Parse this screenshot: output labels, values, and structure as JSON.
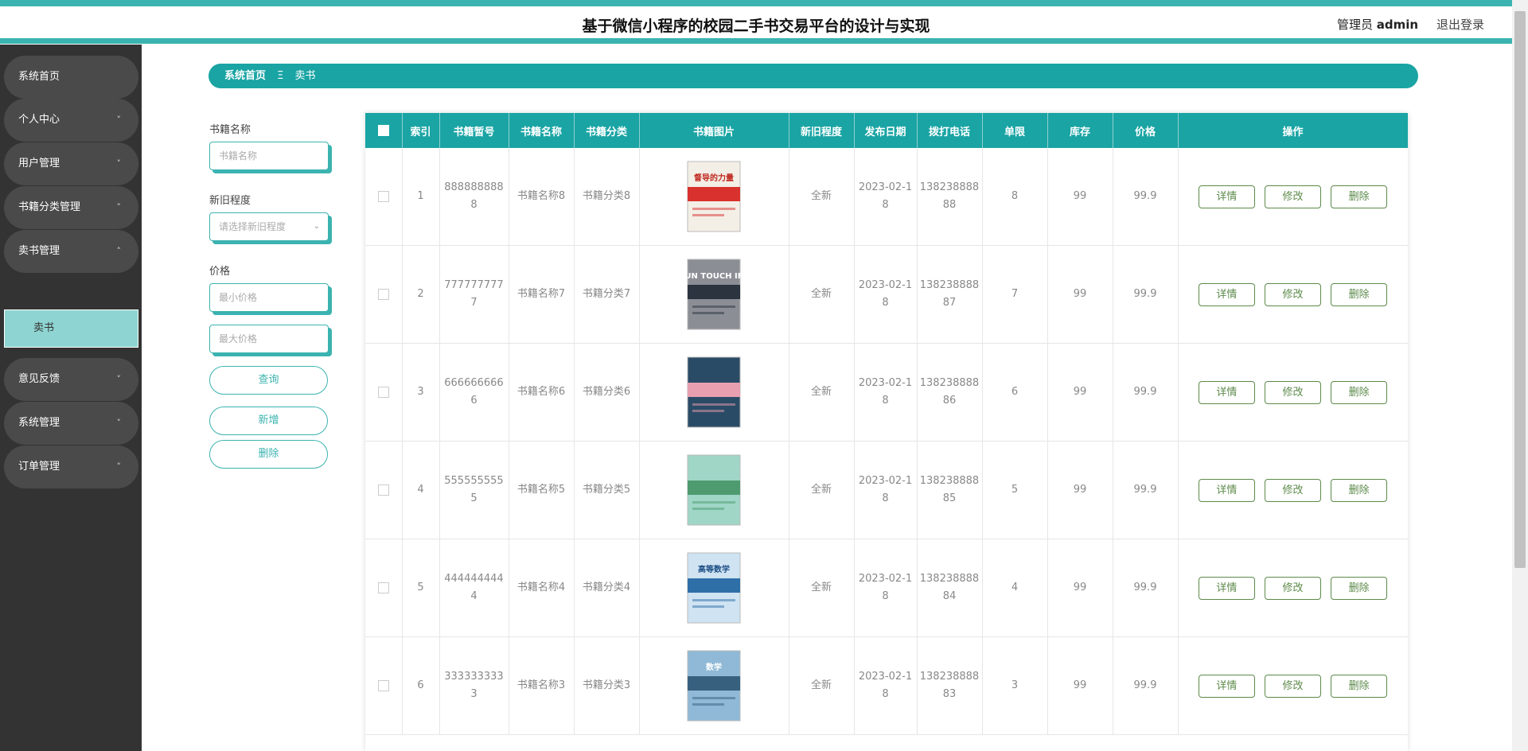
{
  "header": {
    "title": "基于微信小程序的校园二手书交易平台的设计与实现",
    "role": "管理员",
    "user": "admin",
    "logout": "退出登录"
  },
  "sidebar": {
    "items": [
      {
        "label": "系统首页",
        "chevron": ""
      },
      {
        "label": "个人中心",
        "chevron": "˅"
      },
      {
        "label": "用户管理",
        "chevron": "˅"
      },
      {
        "label": "书籍分类管理",
        "chevron": "˅"
      },
      {
        "label": "卖书管理",
        "chevron": "˄"
      },
      {
        "label": "意见反馈",
        "chevron": "˅"
      },
      {
        "label": "系统管理",
        "chevron": "˅"
      },
      {
        "label": "订单管理",
        "chevron": "˅"
      }
    ],
    "sub_item": "卖书"
  },
  "breadcrumb": {
    "home": "系统首页",
    "separator": "Ξ",
    "current": "卖书"
  },
  "filters": {
    "name_label": "书籍名称",
    "name_placeholder": "书籍名称",
    "condition_label": "新旧程度",
    "condition_placeholder": "请选择新旧程度",
    "price_label": "价格",
    "min_placeholder": "最小价格",
    "max_placeholder": "最大价格",
    "query": "查询",
    "add": "新增",
    "delete": "删除"
  },
  "table": {
    "headers": [
      "索引",
      "书籍暂号",
      "书籍名称",
      "书籍分类",
      "书籍图片",
      "新旧程度",
      "发布日期",
      "拨打电话",
      "单限",
      "库存",
      "价格",
      "操作"
    ],
    "actions": {
      "detail": "详情",
      "edit": "修改",
      "delete": "删除"
    },
    "rows": [
      {
        "index": "1",
        "code": "8888888888",
        "name": "书籍名称8",
        "category": "书籍分类8",
        "condition": "全新",
        "date": "2023-02-18",
        "phone": "13823888888",
        "limit": "8",
        "stock": "99",
        "price": "99.9",
        "cover": "red",
        "cover_text": "督导的力量"
      },
      {
        "index": "2",
        "code": "7777777777",
        "name": "书籍名称7",
        "category": "书籍分类7",
        "condition": "全新",
        "date": "2023-02-18",
        "phone": "13823888887",
        "limit": "7",
        "stock": "99",
        "price": "99.9",
        "cover": "dark",
        "cover_text": "UN TOUCH IF"
      },
      {
        "index": "3",
        "code": "6666666666",
        "name": "书籍名称6",
        "category": "书籍分类6",
        "condition": "全新",
        "date": "2023-02-18",
        "phone": "13823888886",
        "limit": "6",
        "stock": "99",
        "price": "99.9",
        "cover": "navy",
        "cover_text": ""
      },
      {
        "index": "4",
        "code": "5555555555",
        "name": "书籍名称5",
        "category": "书籍分类5",
        "condition": "全新",
        "date": "2023-02-18",
        "phone": "13823888885",
        "limit": "5",
        "stock": "99",
        "price": "99.9",
        "cover": "green",
        "cover_text": ""
      },
      {
        "index": "5",
        "code": "4444444444",
        "name": "书籍名称4",
        "category": "书籍分类4",
        "condition": "全新",
        "date": "2023-02-18",
        "phone": "13823888884",
        "limit": "4",
        "stock": "99",
        "price": "99.9",
        "cover": "blue",
        "cover_text": "高等数学"
      },
      {
        "index": "6",
        "code": "3333333333",
        "name": "书籍名称3",
        "category": "书籍分类3",
        "condition": "全新",
        "date": "2023-02-18",
        "phone": "13823888883",
        "limit": "3",
        "stock": "99",
        "price": "99.9",
        "cover": "teal",
        "cover_text": "数学"
      }
    ]
  }
}
